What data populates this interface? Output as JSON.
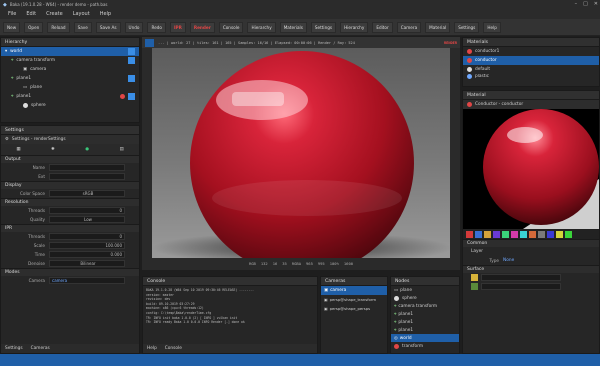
{
  "window": {
    "title": "Baka (19.1.0.28 - W64) - render demo - path.bas"
  },
  "menu": [
    "File",
    "Edit",
    "Create",
    "Layout",
    "Help"
  ],
  "toolbar": {
    "buttons": [
      "New",
      "Open",
      "Reload",
      "Save",
      "Save As",
      "Undo",
      "Redo"
    ],
    "render_buttons": [
      "IPR",
      "Render"
    ],
    "tabs": [
      "Console",
      "Hierarchy",
      "Materials",
      "Settings",
      "Hierarchy",
      "Editor",
      "Camera",
      "Material",
      "Settings",
      "Help"
    ]
  },
  "hierarchy": {
    "title": "Hierarchy",
    "items": [
      "world",
      "camera transform",
      "camera",
      "plane1",
      "plane",
      "plane1",
      "sphere"
    ]
  },
  "settings": {
    "title": "Settings",
    "subtitle": "Settings - renderSettings",
    "sections": [
      {
        "name": "Output",
        "fields": [
          {
            "label": "Name",
            "value": ""
          },
          {
            "label": "Ext",
            "value": ""
          }
        ]
      },
      {
        "name": "Display",
        "fields": [
          {
            "label": "Color Space",
            "value": "sRGB"
          }
        ]
      },
      {
        "name": "Resolution",
        "fields": [
          {
            "label": "Threads",
            "value": "0"
          },
          {
            "label": "Quality",
            "value": "Low"
          }
        ]
      },
      {
        "name": "IPR",
        "fields": [
          {
            "label": "Threads",
            "value": "0"
          },
          {
            "label": "Scale",
            "value": "100.000"
          },
          {
            "label": "Time",
            "value": "0.000"
          },
          {
            "label": "Denoise",
            "value": "Bilinear"
          }
        ]
      },
      {
        "name": "Modes",
        "fields": [
          {
            "label": "Camera",
            "value": "camera"
          }
        ]
      }
    ],
    "tabs": [
      "Settings",
      "Cameras"
    ]
  },
  "viewport": {
    "toolbar": "... | world: 27 | tiles: 161 | 165 | Samples: 16/16 | Elapsed: 00:00:06 | Render / Ray: 524",
    "render_label": "RENDER",
    "status": [
      "RGB",
      "132",
      "16",
      "35",
      "RGBA",
      "965",
      "995",
      "100%",
      "1600"
    ]
  },
  "console": {
    "title": "Console",
    "lines": [
      "BAKA 19.1.0.28 (W64 Sep 10 2019 09:30:46 RELEASE) --------",
      "version:  master",
      "revision: dev",
      "build:    09-10-2019 03:27:29",
      "machine:  x86 (cpu:6 threads:12)",
      "config:   C:\\temp\\Baka\\renderTime.cfg",
      "TR: INFO  init   baka 1.0.0 (2) [ INFO ] vulkan init",
      "TR: INFO  ready  Baka 1.0 0.0.0 INFO Render [-] done ok"
    ],
    "tabs": [
      "Help",
      "Console"
    ]
  },
  "cameras": {
    "title": "Cameras",
    "items": [
      "camera",
      "persp@shape_transform",
      "persp@shape_persps"
    ]
  },
  "nodes": {
    "title": "Nodes",
    "items": [
      "plane",
      "sphere",
      "camera transform",
      "plane1",
      "plane1",
      "plane1",
      "world",
      "transform"
    ]
  },
  "materials": {
    "title": "Materials",
    "items": [
      "conductor1",
      "conductor",
      "default",
      "plastic"
    ]
  },
  "material": {
    "title": "Material",
    "subtitle": "Conductor - conductor"
  },
  "shader": {
    "title": "Common",
    "layers_label": "Layer",
    "fields": [
      {
        "label": "Type",
        "value": "None"
      }
    ],
    "section2": "Surface"
  },
  "swatches": [
    "#d43a3a",
    "#3a6fd4",
    "#d4a23a",
    "#6a3ad4",
    "#3ad47a",
    "#d43aa8",
    "#3ad4d4",
    "#d46a3a",
    "#7a7a7a",
    "#3a3ad4",
    "#d4d43a",
    "#3ad43a"
  ],
  "colors": {
    "accent": "#1f5fa8",
    "sphere": "#c2182e",
    "record": "#e04646"
  }
}
